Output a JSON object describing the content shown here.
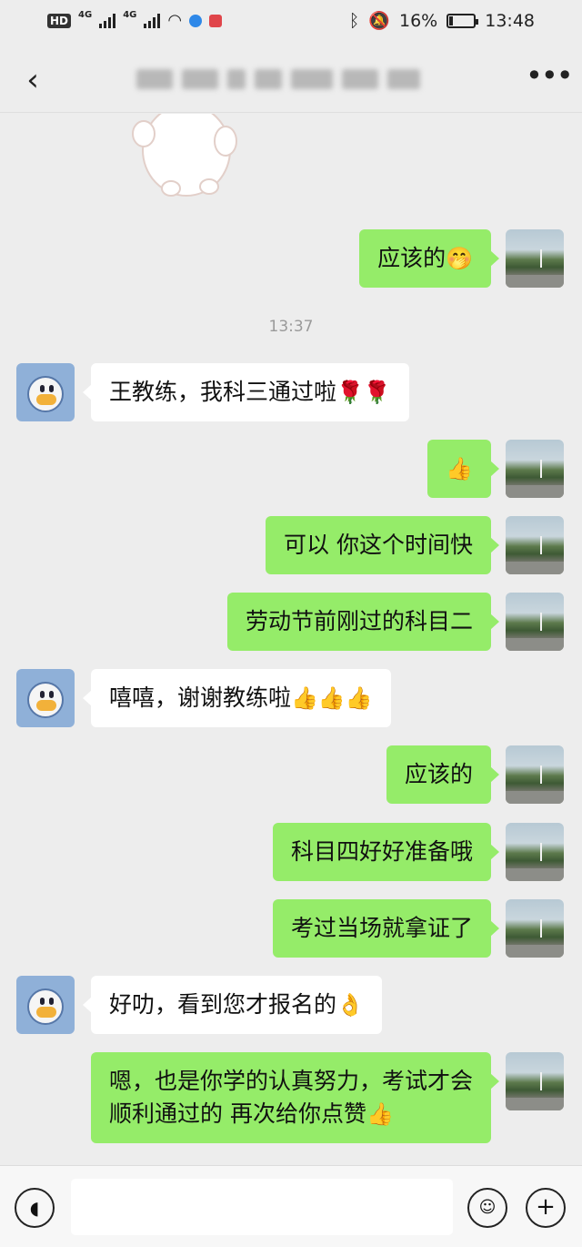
{
  "status_bar": {
    "hd_badge": "HD",
    "network_1": "4G",
    "network_2": "4G",
    "battery_percent": "16%",
    "battery_level": 0.16,
    "time": "13:48"
  },
  "header": {
    "back_icon": "chevron-left-icon",
    "title": "",
    "more_icon": "more-dots-icon"
  },
  "chat": {
    "time_separator": "13:37",
    "messages": [
      {
        "sender": "me",
        "text": "应该的",
        "emoji": "🤭"
      },
      {
        "sender": "friend",
        "text": "王教练，我科三通过啦",
        "emoji": "🌹🌹"
      },
      {
        "sender": "me",
        "text": "",
        "emoji": "👍"
      },
      {
        "sender": "me",
        "text": "可以 你这个时间快",
        "emoji": ""
      },
      {
        "sender": "me",
        "text": "劳动节前刚过的科目二",
        "emoji": ""
      },
      {
        "sender": "friend",
        "text": "嘻嘻，谢谢教练啦",
        "emoji": "👍👍👍"
      },
      {
        "sender": "me",
        "text": "应该的",
        "emoji": ""
      },
      {
        "sender": "me",
        "text": "科目四好好准备哦",
        "emoji": ""
      },
      {
        "sender": "me",
        "text": "考过当场就拿证了",
        "emoji": ""
      },
      {
        "sender": "friend",
        "text": "好叻，看到您才报名的",
        "emoji": "👌"
      },
      {
        "sender": "me",
        "text": "嗯，也是你学的认真努力，考试才会顺利通过的 再次给你点赞",
        "emoji": "👍"
      }
    ]
  },
  "input_bar": {
    "voice_icon": "voice-icon",
    "emoji_icon": "emoji-icon",
    "plus_icon": "plus-icon"
  }
}
